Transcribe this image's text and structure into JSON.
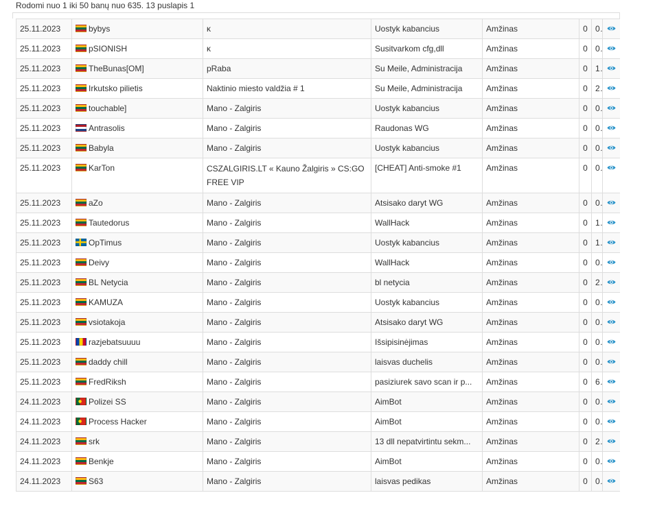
{
  "summary": "Rodomi nuo 1 iki 50 banų nuo 635. 13 puslapis 1",
  "colors": {
    "border": "#dddddd",
    "row_stripe": "#f9f9f9",
    "eye_icon": "#2a93c9"
  },
  "rows": [
    {
      "date": "25.11.2023",
      "flag": "lt",
      "player": "bybys",
      "admin": "ᴋ",
      "reason": "Uostyk kabancius",
      "length": "Amžinas",
      "c1": "0",
      "c2": "0"
    },
    {
      "date": "25.11.2023",
      "flag": "lt",
      "player": "pSIONISH",
      "admin": "ᴋ",
      "reason": "Susitvarkom cfg,dll",
      "length": "Amžinas",
      "c1": "0",
      "c2": "0"
    },
    {
      "date": "25.11.2023",
      "flag": "lt",
      "player": "TheBunas[OM]",
      "admin": "pRaba",
      "reason": "Su Meile, Administracija",
      "length": "Amžinas",
      "c1": "0",
      "c2": "1"
    },
    {
      "date": "25.11.2023",
      "flag": "lt",
      "player": "Irkutsko pilietis",
      "admin": "Naktinio miesto valdžia  # 1",
      "reason": "Su Meile, Administracija",
      "length": "Amžinas",
      "c1": "0",
      "c2": "2"
    },
    {
      "date": "25.11.2023",
      "flag": "lt",
      "player": "touchable]",
      "admin": "Mano - Zalgiris",
      "reason": "Uostyk kabancius",
      "length": "Amžinas",
      "c1": "0",
      "c2": "0"
    },
    {
      "date": "25.11.2023",
      "flag": "nl",
      "player": "Antrasolis",
      "admin": "Mano - Zalgiris",
      "reason": "Raudonas WG",
      "length": "Amžinas",
      "c1": "0",
      "c2": "0"
    },
    {
      "date": "25.11.2023",
      "flag": "lt",
      "player": "Babyla",
      "admin": "Mano - Zalgiris",
      "reason": "Uostyk kabancius",
      "length": "Amžinas",
      "c1": "0",
      "c2": "0"
    },
    {
      "date": "25.11.2023",
      "flag": "lt",
      "player": "KarTon",
      "admin": "CSZALGIRIS.LT « Kauno Žalgiris » CS:GO FREE VIP",
      "reason": "[CHEAT] Anti-smoke #1",
      "length": "Amžinas",
      "c1": "0",
      "c2": "0",
      "tall": true
    },
    {
      "date": "25.11.2023",
      "flag": "lt",
      "player": "aZo",
      "admin": "Mano - Zalgiris",
      "reason": "Atsisako daryt WG",
      "length": "Amžinas",
      "c1": "0",
      "c2": "0"
    },
    {
      "date": "25.11.2023",
      "flag": "lt",
      "player": "Tautedorus",
      "admin": "Mano - Zalgiris",
      "reason": "WallHack",
      "length": "Amžinas",
      "c1": "0",
      "c2": "1"
    },
    {
      "date": "25.11.2023",
      "flag": "se",
      "player": "OpTimus",
      "admin": "Mano - Zalgiris",
      "reason": "Uostyk kabancius",
      "length": "Amžinas",
      "c1": "0",
      "c2": "1"
    },
    {
      "date": "25.11.2023",
      "flag": "lt",
      "player": "Deivy",
      "admin": "Mano - Zalgiris",
      "reason": "WallHack",
      "length": "Amžinas",
      "c1": "0",
      "c2": "0"
    },
    {
      "date": "25.11.2023",
      "flag": "lt",
      "player": "BL Netycia",
      "admin": "Mano - Zalgiris",
      "reason": "bl netycia",
      "length": "Amžinas",
      "c1": "0",
      "c2": "2"
    },
    {
      "date": "25.11.2023",
      "flag": "lt",
      "player": "KAMUZA",
      "admin": "Mano - Zalgiris",
      "reason": "Uostyk kabancius",
      "length": "Amžinas",
      "c1": "0",
      "c2": "0"
    },
    {
      "date": "25.11.2023",
      "flag": "lt",
      "player": "vsiotakoja",
      "admin": "Mano - Zalgiris",
      "reason": "Atsisako daryt WG",
      "length": "Amžinas",
      "c1": "0",
      "c2": "0"
    },
    {
      "date": "25.11.2023",
      "flag": "md",
      "player": "razjebatsuuuu",
      "admin": "Mano - Zalgiris",
      "reason": "Išsipisinėjimas",
      "length": "Amžinas",
      "c1": "0",
      "c2": "0"
    },
    {
      "date": "25.11.2023",
      "flag": "lt",
      "player": "daddy chill",
      "admin": "Mano - Zalgiris",
      "reason": "laisvas duchelis",
      "length": "Amžinas",
      "c1": "0",
      "c2": "0"
    },
    {
      "date": "25.11.2023",
      "flag": "lt",
      "player": "FredRiksh",
      "admin": "Mano - Zalgiris",
      "reason": "pasiziurek savo scan ir p...",
      "length": "Amžinas",
      "c1": "0",
      "c2": "6"
    },
    {
      "date": "24.11.2023",
      "flag": "pt",
      "player": "Polizei SS",
      "admin": "Mano - Zalgiris",
      "reason": "AimBot",
      "length": "Amžinas",
      "c1": "0",
      "c2": "0"
    },
    {
      "date": "24.11.2023",
      "flag": "pt",
      "player": "Process Hacker",
      "admin": "Mano - Zalgiris",
      "reason": "AimBot",
      "length": "Amžinas",
      "c1": "0",
      "c2": "0"
    },
    {
      "date": "24.11.2023",
      "flag": "lt",
      "player": "srk",
      "admin": "Mano - Zalgiris",
      "reason": "13 dll nepatvirtintu sekm...",
      "length": "Amžinas",
      "c1": "0",
      "c2": "2"
    },
    {
      "date": "24.11.2023",
      "flag": "lt",
      "player": "Benkje",
      "admin": "Mano - Zalgiris",
      "reason": "AimBot",
      "length": "Amžinas",
      "c1": "0",
      "c2": "0"
    },
    {
      "date": "24.11.2023",
      "flag": "lt",
      "player": "S63",
      "admin": "Mano - Zalgiris",
      "reason": "laisvas pedikas",
      "length": "Amžinas",
      "c1": "0",
      "c2": "0"
    }
  ]
}
